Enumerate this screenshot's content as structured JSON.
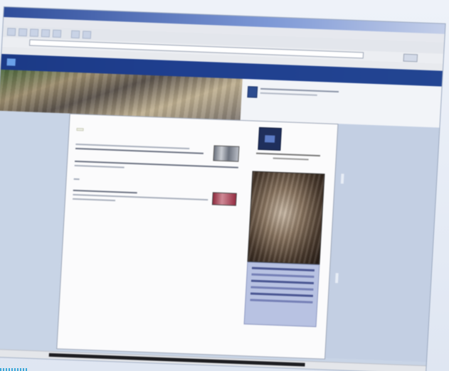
{
  "window": {
    "title": ""
  },
  "menubar": {
    "items": []
  },
  "address": {
    "label": "",
    "url": ""
  },
  "colors": {
    "titlebar": "#2f4d9a",
    "site_header": "#1f3f8f",
    "page_background": "#c8d4e6",
    "sidebar_box": "#b8c2e2",
    "content_background": "#fbfbfc"
  },
  "page": {
    "tab_label": "",
    "small_button_label": "",
    "icons": [
      "site-logo-icon",
      "banner-icon",
      "photo-thumbnail",
      "video-thumbnail",
      "emblem-icon"
    ]
  }
}
